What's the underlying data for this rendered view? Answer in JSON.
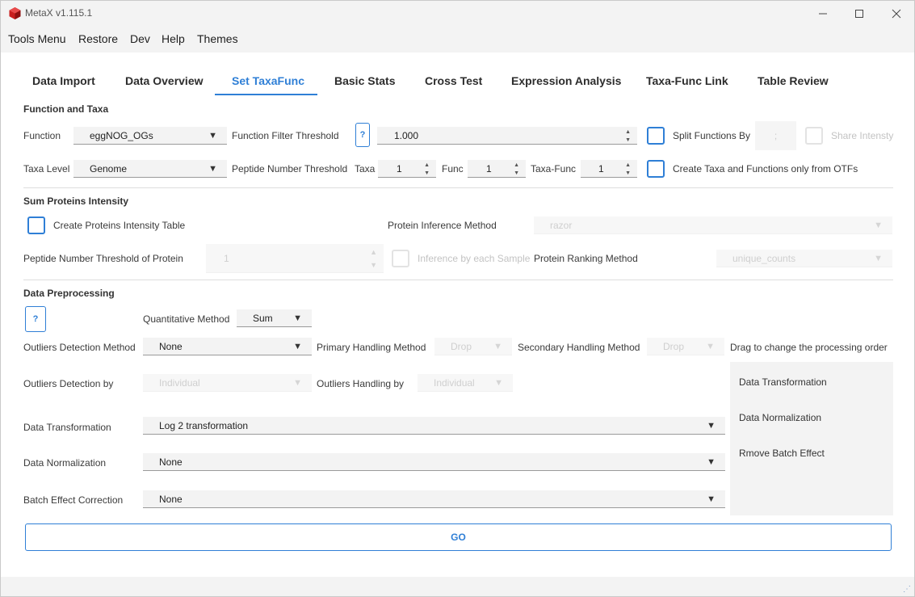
{
  "window": {
    "title": "MetaX v1.115.1"
  },
  "menu": [
    "Tools Menu",
    "Restore",
    "Dev",
    "Help",
    "Themes"
  ],
  "tabs": [
    "Data Import",
    "Data Overview",
    "Set TaxaFunc",
    "Basic Stats",
    "Cross Test",
    "Expression Analysis",
    "Taxa-Func Link",
    "Table Review"
  ],
  "active_tab": "Set TaxaFunc",
  "function_taxa": {
    "section": "Function and Taxa",
    "function_label": "Function",
    "function_value": "eggNOG_OGs",
    "filter_label": "Function Filter Threshold",
    "help": "?",
    "filter_value": "1.000",
    "split_label": "Split Functions By",
    "split_value": ";",
    "share_label": "Share Intensty",
    "taxa_level_label": "Taxa Level",
    "taxa_level_value": "Genome",
    "peptide_threshold_label": "Peptide Number Threshold",
    "taxa_label": "Taxa",
    "taxa_value": "1",
    "func_label": "Func",
    "func_value": "1",
    "taxafunc_label": "Taxa-Func",
    "taxafunc_value": "1",
    "otf_label": "Create Taxa and Functions only from OTFs"
  },
  "sum_proteins": {
    "section": "Sum Proteins Intensity",
    "create_table_label": "Create Proteins Intensity Table",
    "inference_label": "Protein Inference Method",
    "inference_value": "razor",
    "pep_threshold_label": "Peptide Number Threshold of Protein",
    "pep_threshold_value": "1",
    "each_sample_label": "Inference by each Sample",
    "ranking_label": "Protein Ranking Method",
    "ranking_value": "unique_counts"
  },
  "preprocessing": {
    "section": "Data Preprocessing",
    "help": "?",
    "quant_label": "Quantitative Method",
    "quant_value": "Sum",
    "outlier_method_label": "Outliers  Detection Method",
    "outlier_method_value": "None",
    "primary_label": "Primary Handling Method",
    "primary_value": "Drop",
    "secondary_label": "Secondary Handling Method",
    "secondary_value": "Drop",
    "drag_label": "Drag to change the processing order",
    "outlier_by_label": "Outliers  Detection by",
    "outlier_by_value": "Individual",
    "handling_by_label": "Outliers Handling by",
    "handling_by_value": "Individual",
    "transform_label": "Data Transformation",
    "transform_value": "Log 2 transformation",
    "normalize_label": "Data Normalization",
    "normalize_value": "None",
    "batch_label": "Batch Effect Correction",
    "batch_value": "None",
    "order": [
      "Data Transformation",
      "Data Normalization",
      "Rmove Batch Effect"
    ]
  },
  "go_label": "GO",
  "colors": {
    "accent": "#2f7fd6",
    "panel": "#f3f3f3"
  }
}
